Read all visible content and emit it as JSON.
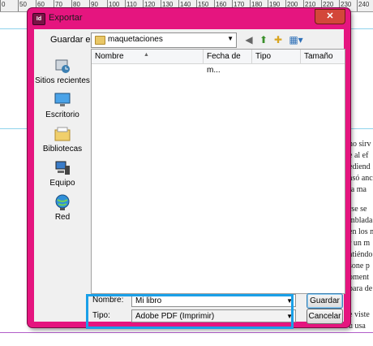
{
  "ruler": {
    "labels": [
      "0",
      "50",
      "60",
      "70",
      "80",
      "90",
      "100",
      "110",
      "120",
      "130",
      "140",
      "150",
      "160",
      "170",
      "180",
      "190",
      "200",
      "210",
      "220",
      "230",
      "240"
    ]
  },
  "background_text": [
    "no sirv",
    "e al ef",
    "ediend",
    "asó anc",
    "ta ma",
    "rse se",
    "mblada",
    "en los n",
    "r un m",
    "atiéndo",
    "sone p",
    "oment",
    "para de",
    "e viste",
    "u usa"
  ],
  "dialog": {
    "title": "Exportar",
    "close_glyph": "✕",
    "look_in_label": "Guardar en:",
    "look_in_value": "maquetaciones",
    "places": [
      {
        "label": "Sitios recientes",
        "icon": "recent-places-icon"
      },
      {
        "label": "Escritorio",
        "icon": "desktop-icon"
      },
      {
        "label": "Bibliotecas",
        "icon": "libraries-icon"
      },
      {
        "label": "Equipo",
        "icon": "computer-icon"
      },
      {
        "label": "Red",
        "icon": "network-icon"
      }
    ],
    "columns": [
      "Nombre",
      "Fecha de m...",
      "Tipo",
      "Tamaño"
    ],
    "name_label": "Nombre:",
    "name_value": "Mi libro",
    "type_label": "Tipo:",
    "type_value": "Adobe PDF (Imprimir)",
    "save_button": "Guardar",
    "cancel_button": "Cancelar"
  },
  "colors": {
    "title_bar": "#e5157f",
    "highlight": "#1aa0e8"
  }
}
